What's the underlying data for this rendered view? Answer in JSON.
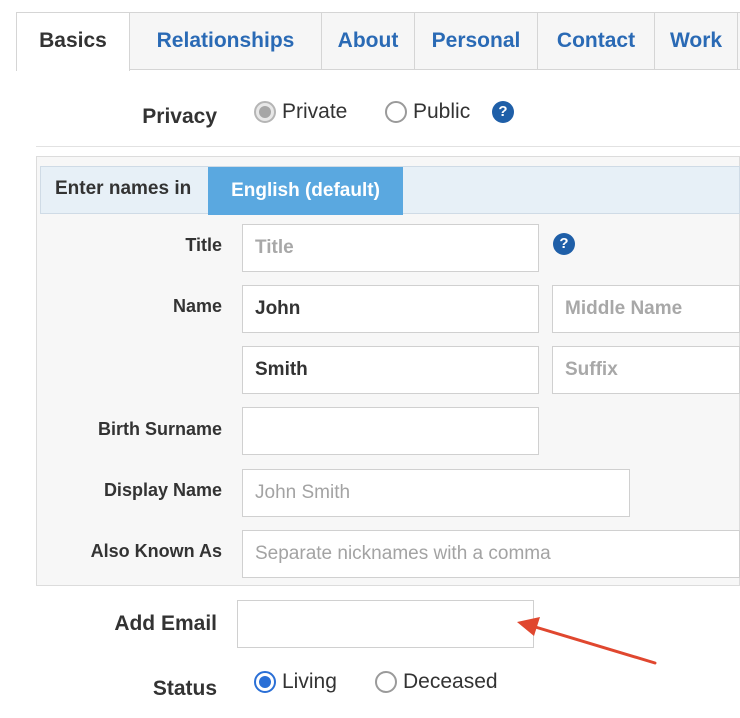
{
  "tabs": {
    "basics": "Basics",
    "relationships": "Relationships",
    "about": "About",
    "personal": "Personal",
    "contact": "Contact",
    "work": "Work"
  },
  "privacy": {
    "label": "Privacy",
    "options": [
      "Private",
      "Public"
    ],
    "selected": "Private"
  },
  "names": {
    "enter_names_label": "Enter names in",
    "language_tab": "English (default)",
    "title_label": "Title",
    "title_placeholder": "Title",
    "name_label": "Name",
    "first_name_value": "John",
    "middle_name_placeholder": "Middle Name",
    "last_name_value": "Smith",
    "suffix_placeholder": "Suffix",
    "birth_surname_label": "Birth Surname",
    "birth_surname_value": "",
    "display_name_label": "Display Name",
    "display_name_placeholder": "John Smith",
    "aka_label": "Also Known As",
    "aka_placeholder": "Separate nicknames with a comma"
  },
  "email": {
    "label": "Add Email",
    "value": ""
  },
  "status": {
    "label": "Status",
    "options": [
      "Living",
      "Deceased"
    ],
    "selected": "Living"
  },
  "help_glyph": "?",
  "colors": {
    "link_blue": "#2a6ab5",
    "language_tab_bg": "#5aa8e0",
    "help_icon_bg": "#1f5fa8",
    "radio_selected": "#2a6fd6",
    "annotation_arrow": "#e0472f"
  }
}
